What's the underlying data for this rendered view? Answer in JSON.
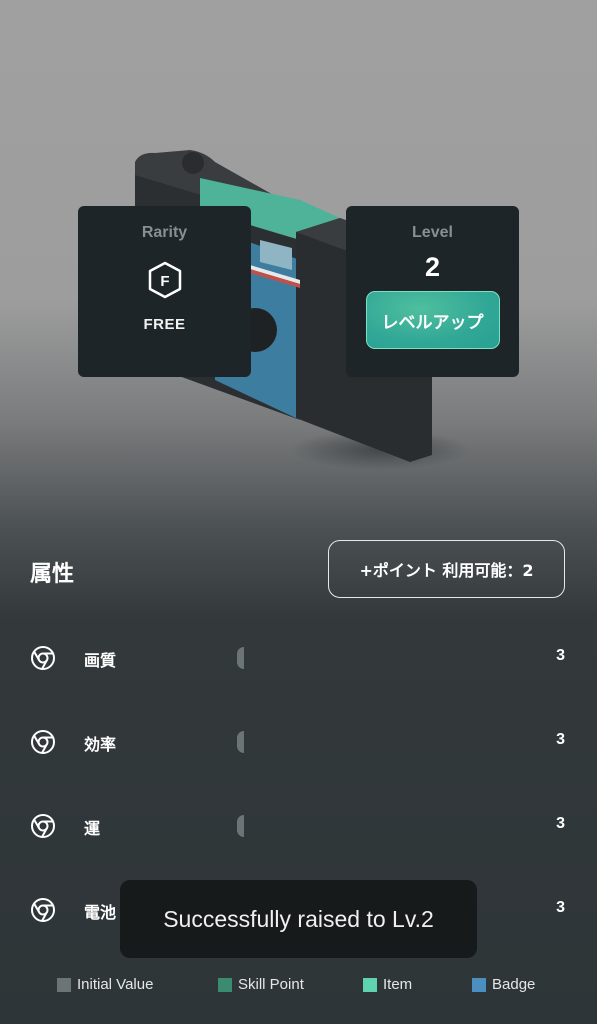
{
  "rarity": {
    "title": "Rarity",
    "badge_letter": "F",
    "value": "FREE"
  },
  "level": {
    "title": "Level",
    "value": "2",
    "level_up_label": "レベルアップ"
  },
  "attributes": {
    "title": "属性",
    "points_button_label": "+ポイント 利用可能：2",
    "items": [
      {
        "name": "画質",
        "value": "3",
        "icon": "chrome-like-icon"
      },
      {
        "name": "効率",
        "value": "3",
        "icon": "chrome-like-icon"
      },
      {
        "name": "運",
        "value": "3",
        "icon": "chrome-like-icon"
      },
      {
        "name": "電池",
        "value": "3",
        "icon": "chrome-like-icon"
      }
    ]
  },
  "toast": {
    "message": "Successfully raised to Lv.2"
  },
  "legend": [
    {
      "label": "Initial Value",
      "color": "#6b7577"
    },
    {
      "label": "Skill Point",
      "color": "#3b8a72"
    },
    {
      "label": "Item",
      "color": "#5fd3b0"
    },
    {
      "label": "Badge",
      "color": "#4a8fbf"
    }
  ],
  "colors": {
    "accent": "#31a796",
    "card_bg": "#1d2528"
  }
}
